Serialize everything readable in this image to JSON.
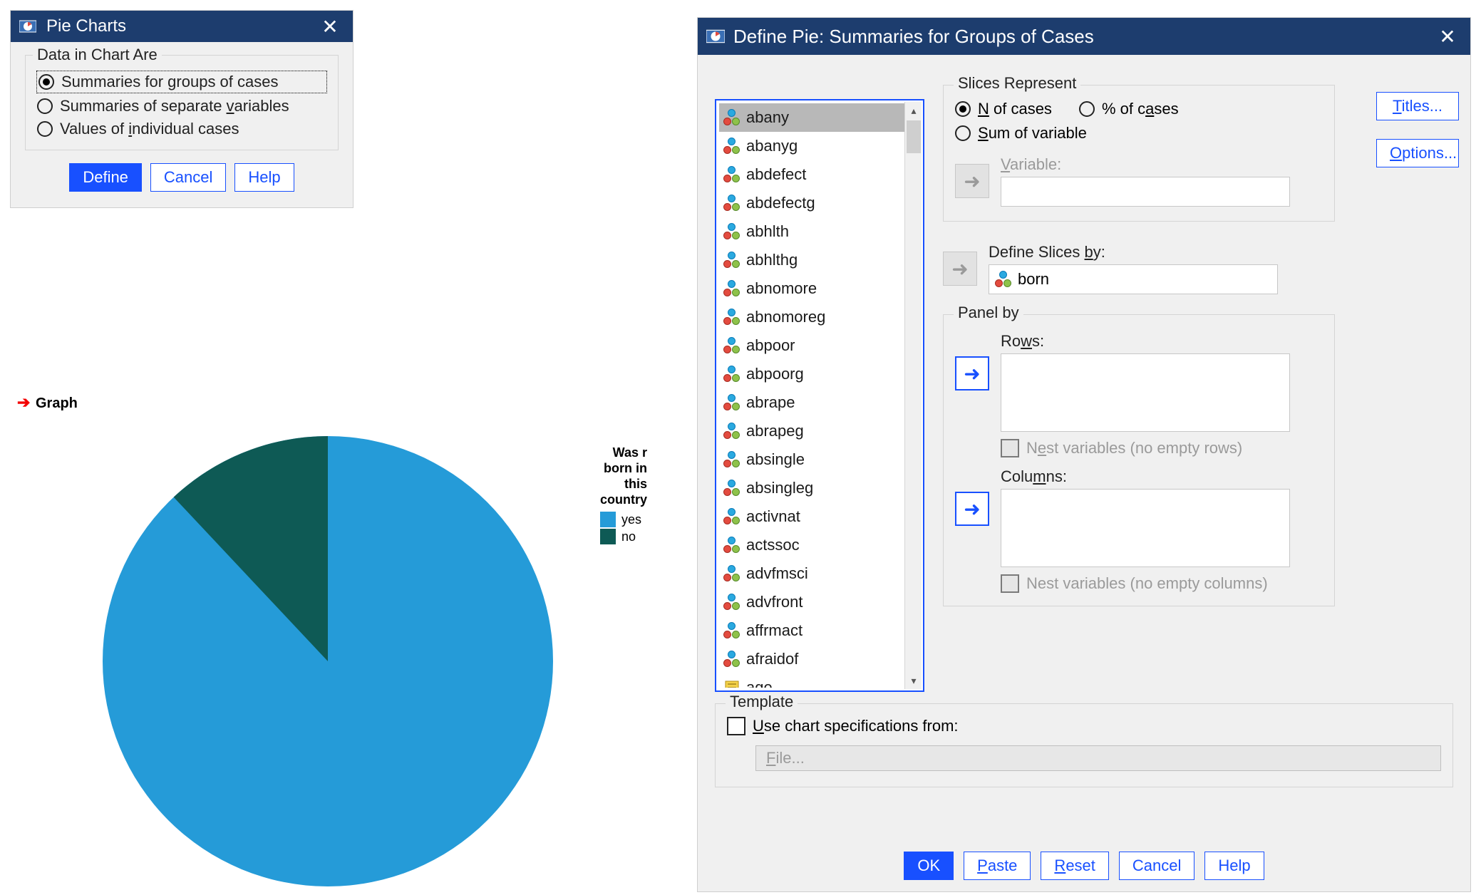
{
  "dlg1": {
    "title": "Pie Charts",
    "group_label": "Data in Chart Are",
    "radios": {
      "opt1": {
        "pre": "Summaries for ",
        "u": "g",
        "post": "roups of cases",
        "selected": true
      },
      "opt2": {
        "pre": "Summaries of separate ",
        "u": "v",
        "post": "ariables",
        "selected": false
      },
      "opt3": {
        "pre": "Values of ",
        "u": "i",
        "post": "ndividual cases",
        "selected": false
      }
    },
    "buttons": {
      "define": "Define",
      "cancel": "Cancel",
      "help": "Help"
    }
  },
  "graph_label": "Graph",
  "chart_data": {
    "type": "pie",
    "title": "Was r born in this country",
    "categories": [
      "yes",
      "no"
    ],
    "values": [
      88,
      12
    ],
    "colors": [
      "#259bd8",
      "#0e5a55"
    ]
  },
  "dlg2": {
    "title": "Define Pie: Summaries for Groups of Cases",
    "variables": [
      {
        "name": "abany",
        "selected": true,
        "measure": "nominal"
      },
      {
        "name": "abanyg",
        "measure": "nominal"
      },
      {
        "name": "abdefect",
        "measure": "nominal"
      },
      {
        "name": "abdefectg",
        "measure": "nominal"
      },
      {
        "name": "abhlth",
        "measure": "nominal"
      },
      {
        "name": "abhlthg",
        "measure": "nominal"
      },
      {
        "name": "abnomore",
        "measure": "nominal"
      },
      {
        "name": "abnomoreg",
        "measure": "nominal"
      },
      {
        "name": "abpoor",
        "measure": "nominal"
      },
      {
        "name": "abpoorg",
        "measure": "nominal"
      },
      {
        "name": "abrape",
        "measure": "nominal"
      },
      {
        "name": "abrapeg",
        "measure": "nominal"
      },
      {
        "name": "absingle",
        "measure": "nominal"
      },
      {
        "name": "absingleg",
        "measure": "nominal"
      },
      {
        "name": "activnat",
        "measure": "nominal"
      },
      {
        "name": "actssoc",
        "measure": "nominal"
      },
      {
        "name": "advfmsci",
        "measure": "nominal"
      },
      {
        "name": "advfront",
        "measure": "nominal"
      },
      {
        "name": "affrmact",
        "measure": "nominal"
      },
      {
        "name": "afraidof",
        "measure": "nominal"
      },
      {
        "name": "age",
        "measure": "scale"
      }
    ],
    "slices_represent": {
      "label": "Slices Represent",
      "n_pre": "",
      "n_u": "N",
      "n_post": " of cases",
      "pct_pre": "% of c",
      "pct_u": "a",
      "pct_post": "ses",
      "sum_pre": "",
      "sum_u": "S",
      "sum_post": "um of variable",
      "selected": "n",
      "variable_label_pre": "",
      "variable_label_u": "V",
      "variable_label_post": "ariable:"
    },
    "define_slices": {
      "label_pre": "Define Slices ",
      "label_u": "b",
      "label_post": "y:",
      "value": "born"
    },
    "panel": {
      "label": "Panel by",
      "rows_label_pre": "Ro",
      "rows_label_u": "w",
      "rows_label_post": "s:",
      "cols_label_pre": "Colu",
      "cols_label_u": "m",
      "cols_label_post": "ns:",
      "nest_rows_pre": "N",
      "nest_rows_u": "e",
      "nest_rows_post": "st variables (no empty rows)",
      "nest_cols": "Nest variables (no empty columns)"
    },
    "template": {
      "label": "Template",
      "use_pre": "",
      "use_u": "U",
      "use_post": "se chart specifications from:",
      "file_btn_pre": "",
      "file_btn_u": "F",
      "file_btn_post": "ile..."
    },
    "side_buttons": {
      "titles_pre": "",
      "titles_u": "T",
      "titles_post": "itles...",
      "options_pre": "",
      "options_u": "O",
      "options_post": "ptions..."
    },
    "footer": {
      "ok": "OK",
      "paste_pre": "",
      "paste_u": "P",
      "paste_post": "aste",
      "reset_pre": "",
      "reset_u": "R",
      "reset_post": "eset",
      "cancel": "Cancel",
      "help": "Help"
    }
  }
}
